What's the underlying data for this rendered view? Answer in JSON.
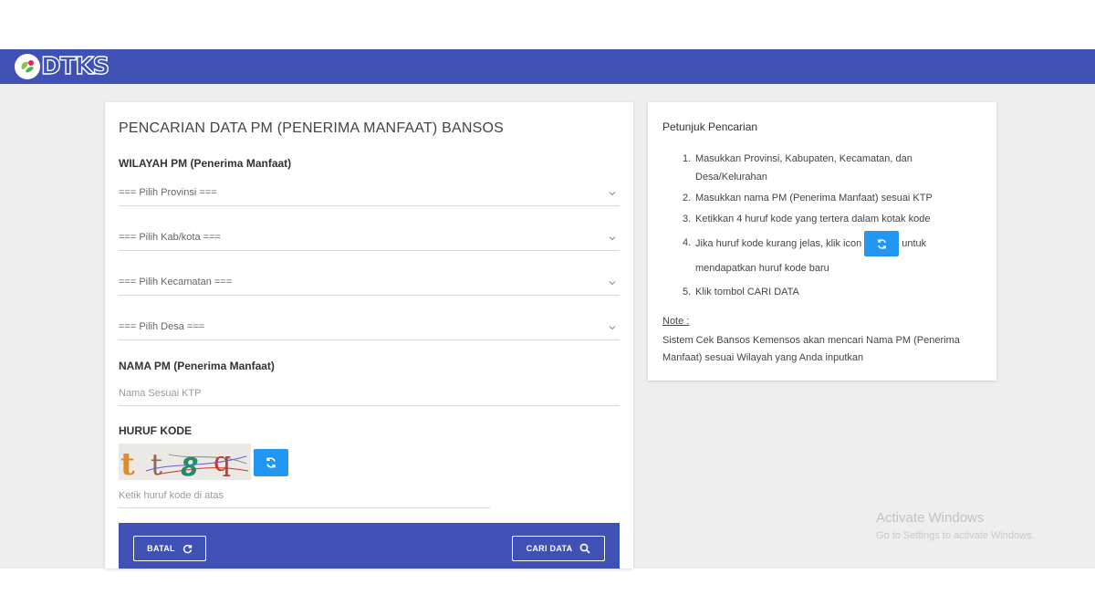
{
  "header": {
    "logo_text": "DTKS",
    "brand_color": "#3f51b5"
  },
  "form": {
    "title": "PENCARIAN DATA PM (PENERIMA MANFAAT) BANSOS",
    "region_label": "WILAYAH PM (Penerima Manfaat)",
    "province_select": "=== Pilih Provinsi ===",
    "regency_select": "=== Pilih Kab/kota ===",
    "district_select": "=== Pilih Kecamatan ===",
    "village_select": "=== Pilih Desa ===",
    "name_label": "NAMA PM (Penerima Manfaat)",
    "name_placeholder": "Nama Sesuai KTP",
    "code_label": "HURUF KODE",
    "captcha_chars": [
      "t",
      "t",
      "8",
      "q"
    ],
    "code_placeholder": "Ketik huruf kode di atas",
    "cancel_button": "BATAL",
    "search_button": "CARI DATA",
    "accent_color": "#2196f3"
  },
  "guide": {
    "title": "Petunjuk Pencarian",
    "steps": [
      {
        "num": "1.",
        "text": "Masukkan Provinsi, Kabupaten, Kecamatan, dan Desa/Kelurahan"
      },
      {
        "num": "2.",
        "text": "Masukkan nama PM (Penerima Manfaat) sesuai KTP"
      },
      {
        "num": "3.",
        "text": "Ketikkan 4 huruf kode yang tertera dalam kotak kode"
      },
      {
        "num": "4.",
        "text_before": "Jika huruf kode kurang jelas, klik icon",
        "text_after": "untuk mendapatkan huruf kode baru"
      },
      {
        "num": "5.",
        "text": "Klik tombol CARI DATA"
      }
    ],
    "note_title": "Note :",
    "note_text": "Sistem Cek Bansos Kemensos akan mencari Nama PM (Penerima Manfaat) sesuai Wilayah yang Anda inputkan"
  },
  "watermark": {
    "title": "Activate Windows",
    "subtitle": "Go to Settings to activate Windows."
  }
}
